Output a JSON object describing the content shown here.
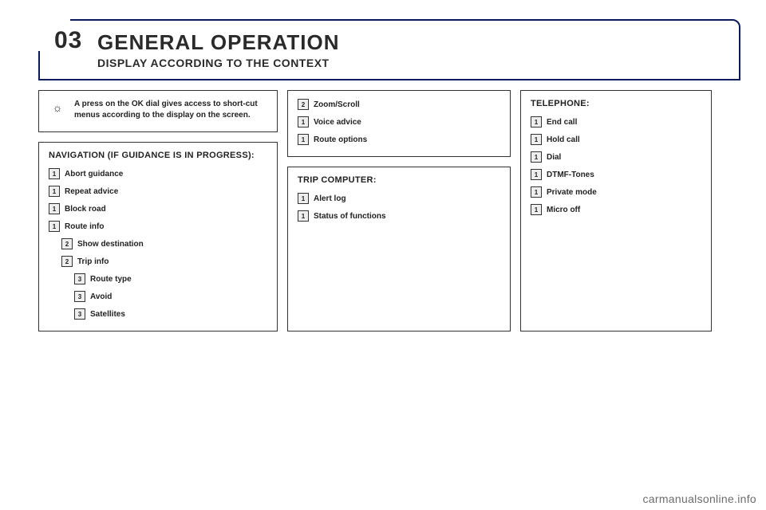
{
  "section_number": "03",
  "title": "GENERAL OPERATION",
  "subtitle": "DISPLAY ACCORDING TO THE CONTEXT",
  "note": {
    "icon": "☼",
    "text": "A press on the OK dial gives access to short-cut menus according to the display on the screen."
  },
  "navigation": {
    "heading": "NAVIGATION (IF GUIDANCE IS IN PROGRESS):",
    "items": [
      {
        "level": "1",
        "indent": 0,
        "label": "Abort guidance"
      },
      {
        "level": "1",
        "indent": 0,
        "label": "Repeat advice"
      },
      {
        "level": "1",
        "indent": 0,
        "label": "Block road"
      },
      {
        "level": "1",
        "indent": 0,
        "label": "Route info"
      },
      {
        "level": "2",
        "indent": 1,
        "label": "Show destination"
      },
      {
        "level": "2",
        "indent": 1,
        "label": "Trip info"
      },
      {
        "level": "3",
        "indent": 2,
        "label": "Route type"
      },
      {
        "level": "3",
        "indent": 2,
        "label": "Avoid"
      },
      {
        "level": "3",
        "indent": 2,
        "label": "Satellites"
      }
    ]
  },
  "navigation_extra": {
    "items": [
      {
        "level": "2",
        "indent": 0,
        "label": "Zoom/Scroll"
      },
      {
        "level": "1",
        "indent": 0,
        "label": "Voice advice"
      },
      {
        "level": "1",
        "indent": 0,
        "label": "Route options"
      }
    ]
  },
  "trip_computer": {
    "heading": "TRIP COMPUTER:",
    "items": [
      {
        "level": "1",
        "indent": 0,
        "label": "Alert log"
      },
      {
        "level": "1",
        "indent": 0,
        "label": "Status of functions"
      }
    ]
  },
  "telephone": {
    "heading": "TELEPHONE:",
    "items": [
      {
        "level": "1",
        "indent": 0,
        "label": "End call"
      },
      {
        "level": "1",
        "indent": 0,
        "label": "Hold call"
      },
      {
        "level": "1",
        "indent": 0,
        "label": "Dial"
      },
      {
        "level": "1",
        "indent": 0,
        "label": "DTMF-Tones"
      },
      {
        "level": "1",
        "indent": 0,
        "label": "Private mode"
      },
      {
        "level": "1",
        "indent": 0,
        "label": "Micro off"
      }
    ]
  },
  "watermark": "carmanualsonline.info"
}
